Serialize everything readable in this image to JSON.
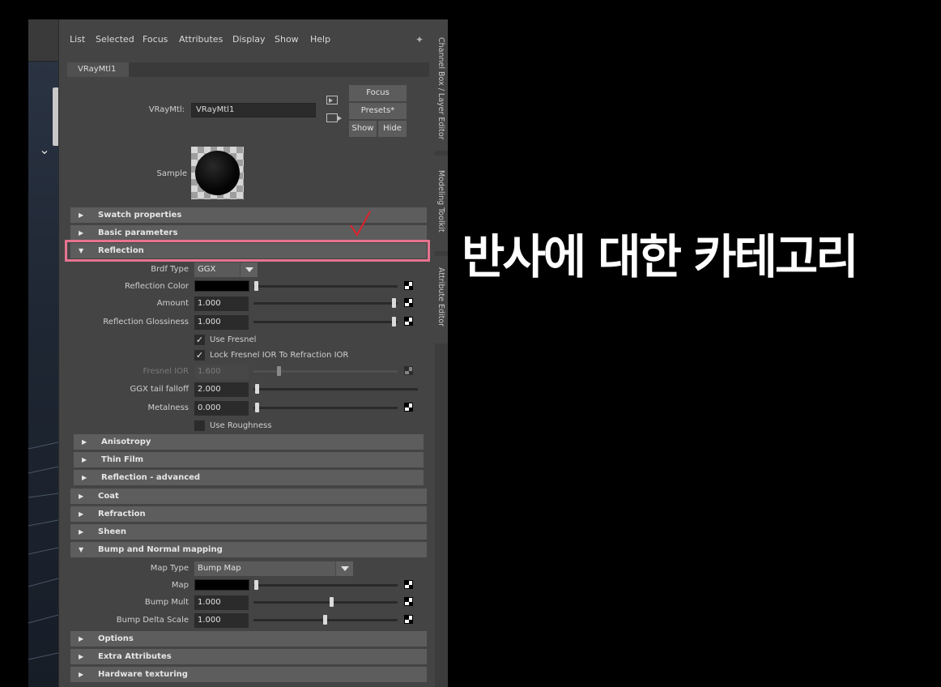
{
  "menu": [
    "List",
    "Selected",
    "Focus",
    "Attributes",
    "Display",
    "Show",
    "Help"
  ],
  "tab": "VRayMtl1",
  "node": {
    "label": "VRayMtl:",
    "value": "VRayMtl1"
  },
  "buttons": {
    "focus": "Focus",
    "presets": "Presets*",
    "show": "Show",
    "hide": "Hide"
  },
  "sample_label": "Sample",
  "sections_top": [
    "Swatch properties",
    "Basic parameters",
    "Reflection"
  ],
  "reflection": {
    "brdf_type_label": "Brdf Type",
    "brdf_type_value": "GGX",
    "reflection_color_label": "Reflection Color",
    "amount_label": "Amount",
    "amount_value": "1.000",
    "glossiness_label": "Reflection Glossiness",
    "glossiness_value": "1.000",
    "use_fresnel": "Use Fresnel",
    "lock_fresnel": "Lock Fresnel IOR To Refraction IOR",
    "fresnel_ior_label": "Fresnel IOR",
    "fresnel_ior_value": "1.600",
    "ggx_tail_label": "GGX tail falloff",
    "ggx_tail_value": "2.000",
    "metalness_label": "Metalness",
    "metalness_value": "0.000",
    "use_roughness": "Use Roughness"
  },
  "sub_sections": [
    "Anisotropy",
    "Thin Film",
    "Reflection - advanced"
  ],
  "sections_mid": [
    "Coat",
    "Refraction",
    "Sheen",
    "Bump and Normal mapping"
  ],
  "bump": {
    "map_type_label": "Map Type",
    "map_type_value": "Bump Map",
    "map_label": "Map",
    "bump_mult_label": "Bump Mult",
    "bump_mult_value": "1.000",
    "bump_delta_label": "Bump Delta Scale",
    "bump_delta_value": "1.000"
  },
  "sections_bottom": [
    "Options",
    "Extra Attributes",
    "Hardware texturing"
  ],
  "side_tabs": [
    "Channel Box / Layer Editor",
    "Modeling Toolkit",
    "Attribute Editor"
  ],
  "annotation": "반사에 대한 카테고리",
  "colors": {
    "highlight": "#e6738f",
    "check": "#e0202a"
  }
}
